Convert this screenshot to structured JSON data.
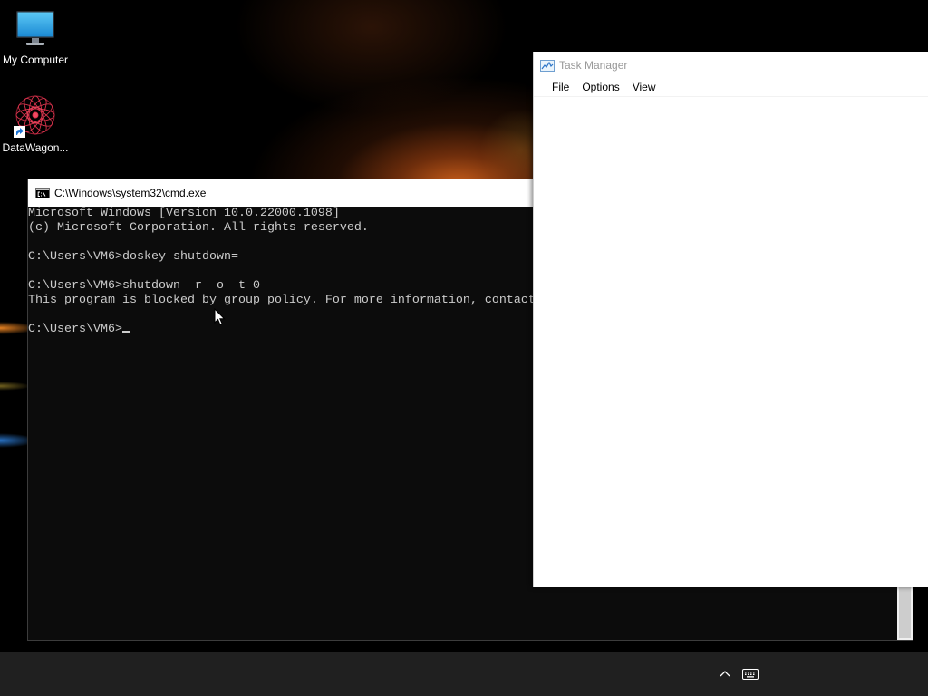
{
  "desktop": {
    "icons": [
      {
        "label": "My Computer",
        "icon": "monitor-icon"
      },
      {
        "label": "DataWagon...",
        "icon": "datawagon-app-icon"
      }
    ]
  },
  "cmd": {
    "title": "C:\\Windows\\system32\\cmd.exe",
    "icon": "console-icon",
    "lines": [
      "Microsoft Windows [Version 10.0.22000.1098]",
      "(c) Microsoft Corporation. All rights reserved.",
      "",
      "C:\\Users\\VM6>doskey shutdown=",
      "",
      "C:\\Users\\VM6>shutdown -r -o -t 0",
      "This program is blocked by group policy. For more information, contact",
      "",
      "C:\\Users\\VM6>"
    ]
  },
  "task_manager": {
    "title": "Task Manager",
    "icon": "task-manager-icon",
    "menu": [
      "File",
      "Options",
      "View"
    ]
  },
  "taskbar": {
    "tray_icons": [
      "chevron-up-icon",
      "keyboard-icon"
    ]
  },
  "pointer": {
    "icon": "mouse-pointer-icon"
  },
  "colors": {
    "console_background": "#0c0c0c",
    "console_text": "#cccccc",
    "taskbar_background": "#202020",
    "inactive_title_text": "#999999"
  }
}
